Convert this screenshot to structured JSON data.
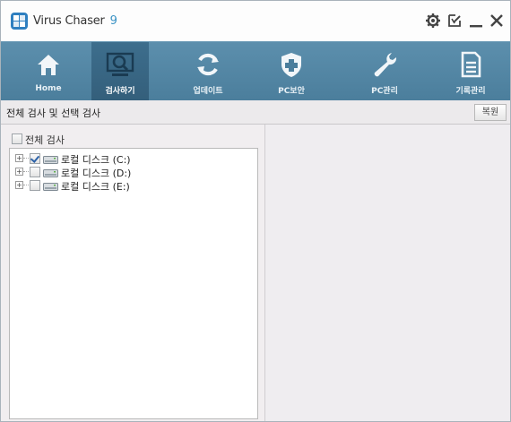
{
  "app": {
    "name": "Virus Chaser",
    "version": "9"
  },
  "title_controls": [
    {
      "name": "settings",
      "icon": "gear-icon"
    },
    {
      "name": "edit-note",
      "icon": "edit-note-icon"
    },
    {
      "name": "minimize",
      "icon": "minimize-icon"
    },
    {
      "name": "close",
      "icon": "close-icon"
    }
  ],
  "nav": {
    "items": [
      {
        "label": "Home",
        "icon": "home-icon",
        "active": false
      },
      {
        "label": "검사하기",
        "icon": "magnifier-icon",
        "active": true
      },
      {
        "label": "업데이트",
        "icon": "refresh-icon",
        "active": false
      },
      {
        "label": "PC보안",
        "icon": "shield-icon",
        "active": false
      },
      {
        "label": "PC관리",
        "icon": "wrench-icon",
        "active": false
      },
      {
        "label": "기록관리",
        "icon": "document-icon",
        "active": false
      }
    ]
  },
  "section": {
    "title": "전체 검사 및 선택 검사",
    "restore_label": "복원"
  },
  "scan": {
    "all_label": "전체 검사",
    "all_checked": false,
    "drives": [
      {
        "label": "로컬 디스크 (C:)",
        "checked": true
      },
      {
        "label": "로컬 디스크 (D:)",
        "checked": false
      },
      {
        "label": "로컬 디스크 (E:)",
        "checked": false
      }
    ],
    "expander_symbol": "+"
  },
  "colors": {
    "nav_bg": "#5486a5",
    "nav_active": "#3a6989",
    "accent": "#3a92c4"
  }
}
